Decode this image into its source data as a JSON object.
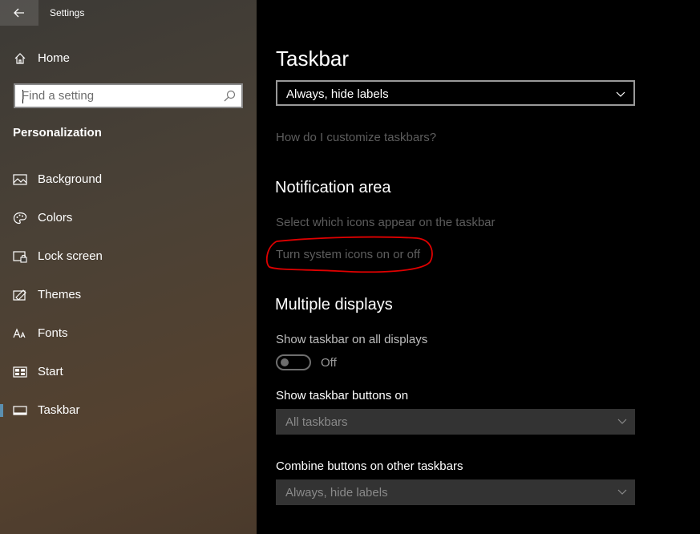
{
  "window": {
    "title": "Settings"
  },
  "sidebar": {
    "home_label": "Home",
    "search": {
      "placeholder": "Find a setting",
      "value": ""
    },
    "section_label": "Personalization",
    "items": [
      {
        "label": "Background",
        "icon": "picture-icon"
      },
      {
        "label": "Colors",
        "icon": "palette-icon"
      },
      {
        "label": "Lock screen",
        "icon": "lock-screen-icon"
      },
      {
        "label": "Themes",
        "icon": "themes-icon"
      },
      {
        "label": "Fonts",
        "icon": "fonts-icon"
      },
      {
        "label": "Start",
        "icon": "start-icon"
      },
      {
        "label": "Taskbar",
        "icon": "taskbar-icon",
        "selected": true
      }
    ]
  },
  "main": {
    "title": "Taskbar",
    "combine_dropdown_value": "Always, hide labels",
    "customize_link": "How do I customize taskbars?",
    "notification_area": {
      "heading": "Notification area",
      "select_icons_link": "Select which icons appear on the taskbar",
      "system_icons_link": "Turn system icons on or off"
    },
    "multiple_displays": {
      "heading": "Multiple displays",
      "show_all_label": "Show taskbar on all displays",
      "toggle_state": "Off",
      "buttons_on_label": "Show taskbar buttons on",
      "buttons_on_value": "All taskbars",
      "combine_other_label": "Combine buttons on other taskbars",
      "combine_other_value": "Always, hide labels"
    }
  },
  "colors": {
    "annotation": "#e00000",
    "accent": "#5b8fb0"
  }
}
